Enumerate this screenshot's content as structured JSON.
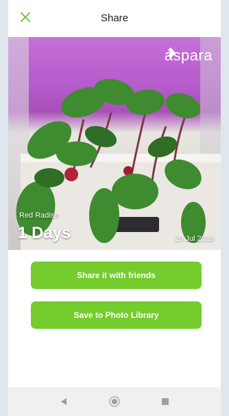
{
  "header": {
    "title": "Share",
    "close_icon": "close-icon"
  },
  "photo": {
    "brand": "aspara",
    "plant_name": "Red Radish",
    "days": "1 Days",
    "date": "29 Jul 2019"
  },
  "actions": {
    "share_label": "Share it with friends",
    "save_label": "Save to Photo Library"
  },
  "colors": {
    "accent": "#74cc2d",
    "close_icon": "#6cc13f"
  },
  "navbar": {
    "icons": [
      "back-icon",
      "home-icon",
      "recents-icon"
    ]
  }
}
